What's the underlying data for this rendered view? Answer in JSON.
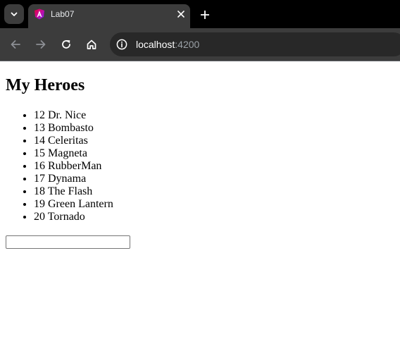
{
  "browser": {
    "tab": {
      "title": "Lab07",
      "close_glyph": "✕"
    },
    "new_tab_glyph": "+",
    "address": {
      "host": "localhost",
      "port": ":4200"
    },
    "icons": {
      "tab_search": "chevron-down-icon",
      "favicon": "angular-icon",
      "back": "arrow-left-icon",
      "forward": "arrow-right-icon",
      "reload": "reload-icon",
      "home": "home-icon",
      "site_info": "info-icon"
    },
    "colors": {
      "tabstrip": "#000000",
      "toolbar": "#3c3c3c",
      "omnibox": "#282828"
    }
  },
  "page": {
    "heading": "My Heroes",
    "heroes": [
      {
        "id": "12",
        "name": "Dr. Nice"
      },
      {
        "id": "13",
        "name": "Bombasto"
      },
      {
        "id": "14",
        "name": "Celeritas"
      },
      {
        "id": "15",
        "name": "Magneta"
      },
      {
        "id": "16",
        "name": "RubberMan"
      },
      {
        "id": "17",
        "name": "Dynama"
      },
      {
        "id": "18",
        "name": "The Flash"
      },
      {
        "id": "19",
        "name": "Green Lantern"
      },
      {
        "id": "20",
        "name": "Tornado"
      }
    ],
    "input": {
      "value": "",
      "placeholder": ""
    }
  }
}
